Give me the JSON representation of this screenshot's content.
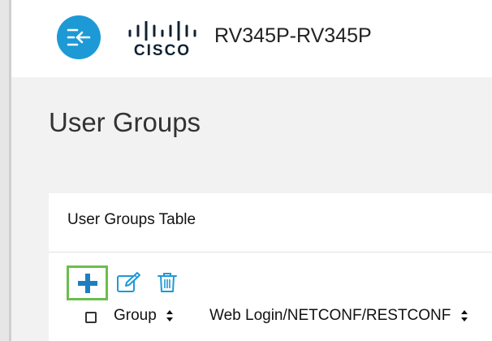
{
  "header": {
    "menu_icon": "collapse-menu-icon",
    "brand": "CISCO",
    "device_name": "RV345P-RV345P",
    "accent_color": "#1d9ad6"
  },
  "page": {
    "title": "User Groups"
  },
  "table": {
    "title": "User Groups Table",
    "toolbar": {
      "add_icon": "plus-icon",
      "edit_icon": "edit-icon",
      "delete_icon": "trash-icon",
      "add_highlight_color": "#6abf4b",
      "icon_color": "#1d9ad6"
    },
    "columns": [
      {
        "label": "Group",
        "sort_icon": "sort-icon"
      },
      {
        "label": "Web Login/NETCONF/RESTCONF",
        "sort_icon": "sort-icon"
      }
    ]
  }
}
